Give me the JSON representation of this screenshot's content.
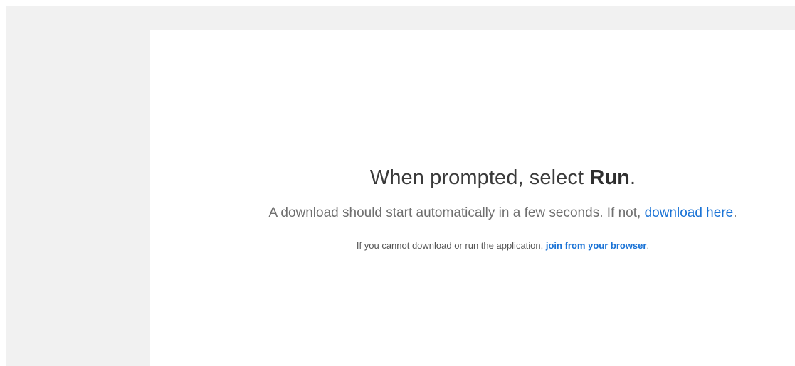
{
  "headline": {
    "prefix": "When prompted, select ",
    "emphasis": "Run",
    "suffix": "."
  },
  "download_line": {
    "text": "A download should start automatically in a few seconds. If not, ",
    "link_label": "download here",
    "suffix": "."
  },
  "browser_line": {
    "text": "If you cannot download or run the application, ",
    "link_label": "join from your browser",
    "suffix": "."
  },
  "colors": {
    "link": "#1a73d6",
    "backdrop": "#f1f1f1",
    "headline": "#3a3a3a",
    "body_text": "#6f6f6f"
  }
}
